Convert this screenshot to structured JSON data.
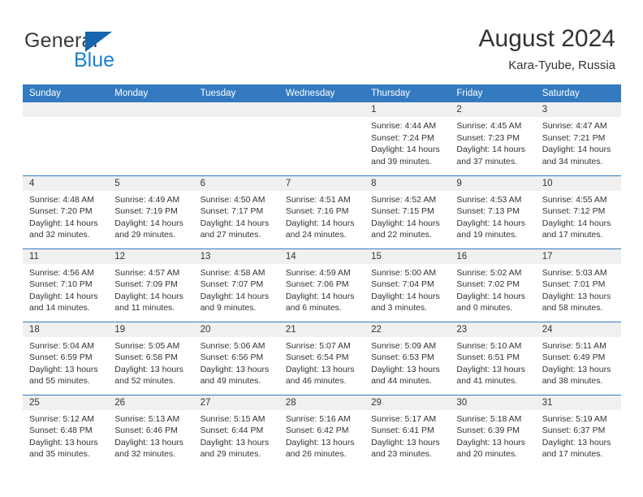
{
  "logo": {
    "word_top": "General",
    "word_bottom": "Blue",
    "triangle_color": "#1565b0",
    "blue_text_color": "#1a7fd4"
  },
  "header": {
    "title": "August 2024",
    "subtitle": "Kara-Tyube, Russia"
  },
  "theme": {
    "header_bar_color": "#337ac0",
    "row_divider_color": "#337ac0",
    "daynum_band_color": "#f0f0f0",
    "text_color": "#333333"
  },
  "weekday_headers": [
    "Sunday",
    "Monday",
    "Tuesday",
    "Wednesday",
    "Thursday",
    "Friday",
    "Saturday"
  ],
  "weeks": [
    [
      {
        "day": "",
        "lines": []
      },
      {
        "day": "",
        "lines": []
      },
      {
        "day": "",
        "lines": []
      },
      {
        "day": "",
        "lines": []
      },
      {
        "day": "1",
        "lines": [
          "Sunrise: 4:44 AM",
          "Sunset: 7:24 PM",
          "Daylight: 14 hours",
          "and 39 minutes."
        ]
      },
      {
        "day": "2",
        "lines": [
          "Sunrise: 4:45 AM",
          "Sunset: 7:23 PM",
          "Daylight: 14 hours",
          "and 37 minutes."
        ]
      },
      {
        "day": "3",
        "lines": [
          "Sunrise: 4:47 AM",
          "Sunset: 7:21 PM",
          "Daylight: 14 hours",
          "and 34 minutes."
        ]
      }
    ],
    [
      {
        "day": "4",
        "lines": [
          "Sunrise: 4:48 AM",
          "Sunset: 7:20 PM",
          "Daylight: 14 hours",
          "and 32 minutes."
        ]
      },
      {
        "day": "5",
        "lines": [
          "Sunrise: 4:49 AM",
          "Sunset: 7:19 PM",
          "Daylight: 14 hours",
          "and 29 minutes."
        ]
      },
      {
        "day": "6",
        "lines": [
          "Sunrise: 4:50 AM",
          "Sunset: 7:17 PM",
          "Daylight: 14 hours",
          "and 27 minutes."
        ]
      },
      {
        "day": "7",
        "lines": [
          "Sunrise: 4:51 AM",
          "Sunset: 7:16 PM",
          "Daylight: 14 hours",
          "and 24 minutes."
        ]
      },
      {
        "day": "8",
        "lines": [
          "Sunrise: 4:52 AM",
          "Sunset: 7:15 PM",
          "Daylight: 14 hours",
          "and 22 minutes."
        ]
      },
      {
        "day": "9",
        "lines": [
          "Sunrise: 4:53 AM",
          "Sunset: 7:13 PM",
          "Daylight: 14 hours",
          "and 19 minutes."
        ]
      },
      {
        "day": "10",
        "lines": [
          "Sunrise: 4:55 AM",
          "Sunset: 7:12 PM",
          "Daylight: 14 hours",
          "and 17 minutes."
        ]
      }
    ],
    [
      {
        "day": "11",
        "lines": [
          "Sunrise: 4:56 AM",
          "Sunset: 7:10 PM",
          "Daylight: 14 hours",
          "and 14 minutes."
        ]
      },
      {
        "day": "12",
        "lines": [
          "Sunrise: 4:57 AM",
          "Sunset: 7:09 PM",
          "Daylight: 14 hours",
          "and 11 minutes."
        ]
      },
      {
        "day": "13",
        "lines": [
          "Sunrise: 4:58 AM",
          "Sunset: 7:07 PM",
          "Daylight: 14 hours",
          "and 9 minutes."
        ]
      },
      {
        "day": "14",
        "lines": [
          "Sunrise: 4:59 AM",
          "Sunset: 7:06 PM",
          "Daylight: 14 hours",
          "and 6 minutes."
        ]
      },
      {
        "day": "15",
        "lines": [
          "Sunrise: 5:00 AM",
          "Sunset: 7:04 PM",
          "Daylight: 14 hours",
          "and 3 minutes."
        ]
      },
      {
        "day": "16",
        "lines": [
          "Sunrise: 5:02 AM",
          "Sunset: 7:02 PM",
          "Daylight: 14 hours",
          "and 0 minutes."
        ]
      },
      {
        "day": "17",
        "lines": [
          "Sunrise: 5:03 AM",
          "Sunset: 7:01 PM",
          "Daylight: 13 hours",
          "and 58 minutes."
        ]
      }
    ],
    [
      {
        "day": "18",
        "lines": [
          "Sunrise: 5:04 AM",
          "Sunset: 6:59 PM",
          "Daylight: 13 hours",
          "and 55 minutes."
        ]
      },
      {
        "day": "19",
        "lines": [
          "Sunrise: 5:05 AM",
          "Sunset: 6:58 PM",
          "Daylight: 13 hours",
          "and 52 minutes."
        ]
      },
      {
        "day": "20",
        "lines": [
          "Sunrise: 5:06 AM",
          "Sunset: 6:56 PM",
          "Daylight: 13 hours",
          "and 49 minutes."
        ]
      },
      {
        "day": "21",
        "lines": [
          "Sunrise: 5:07 AM",
          "Sunset: 6:54 PM",
          "Daylight: 13 hours",
          "and 46 minutes."
        ]
      },
      {
        "day": "22",
        "lines": [
          "Sunrise: 5:09 AM",
          "Sunset: 6:53 PM",
          "Daylight: 13 hours",
          "and 44 minutes."
        ]
      },
      {
        "day": "23",
        "lines": [
          "Sunrise: 5:10 AM",
          "Sunset: 6:51 PM",
          "Daylight: 13 hours",
          "and 41 minutes."
        ]
      },
      {
        "day": "24",
        "lines": [
          "Sunrise: 5:11 AM",
          "Sunset: 6:49 PM",
          "Daylight: 13 hours",
          "and 38 minutes."
        ]
      }
    ],
    [
      {
        "day": "25",
        "lines": [
          "Sunrise: 5:12 AM",
          "Sunset: 6:48 PM",
          "Daylight: 13 hours",
          "and 35 minutes."
        ]
      },
      {
        "day": "26",
        "lines": [
          "Sunrise: 5:13 AM",
          "Sunset: 6:46 PM",
          "Daylight: 13 hours",
          "and 32 minutes."
        ]
      },
      {
        "day": "27",
        "lines": [
          "Sunrise: 5:15 AM",
          "Sunset: 6:44 PM",
          "Daylight: 13 hours",
          "and 29 minutes."
        ]
      },
      {
        "day": "28",
        "lines": [
          "Sunrise: 5:16 AM",
          "Sunset: 6:42 PM",
          "Daylight: 13 hours",
          "and 26 minutes."
        ]
      },
      {
        "day": "29",
        "lines": [
          "Sunrise: 5:17 AM",
          "Sunset: 6:41 PM",
          "Daylight: 13 hours",
          "and 23 minutes."
        ]
      },
      {
        "day": "30",
        "lines": [
          "Sunrise: 5:18 AM",
          "Sunset: 6:39 PM",
          "Daylight: 13 hours",
          "and 20 minutes."
        ]
      },
      {
        "day": "31",
        "lines": [
          "Sunrise: 5:19 AM",
          "Sunset: 6:37 PM",
          "Daylight: 13 hours",
          "and 17 minutes."
        ]
      }
    ]
  ]
}
